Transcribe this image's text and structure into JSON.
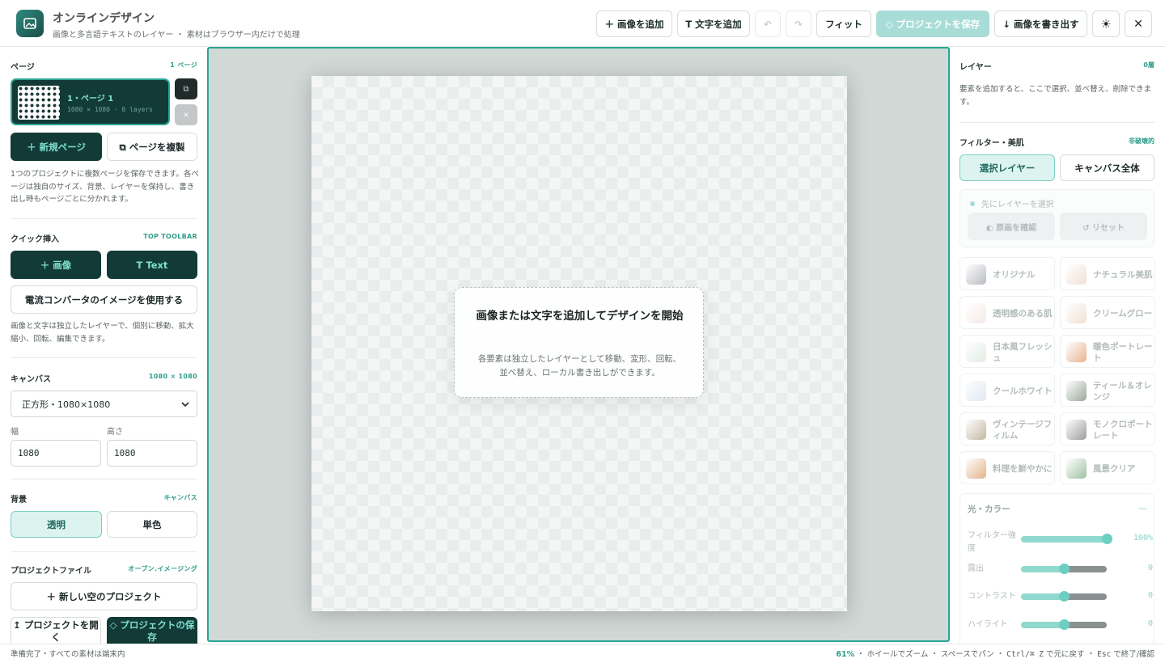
{
  "header": {
    "title": "オンラインデザイン",
    "subtitle": "画像と多言語テキストのレイヤー ・ 素材はブラウザー内だけで処理",
    "buttons": {
      "add_image": "＋ 画像を追加",
      "add_text": "T 文字を追加",
      "undo": "↶",
      "redo": "↷",
      "fit": "フィット",
      "save_project": "◇ プロジェクトを保存",
      "export": "↓ 画像を書き出す",
      "theme": "☀",
      "close": "✕"
    }
  },
  "left": {
    "pages": {
      "label": "ページ",
      "count": "1 ページ",
      "card_name": "1・ページ 1",
      "card_meta": "1080 × 1080 · 0 layers",
      "dup_icon": "⧉",
      "del_icon": "×",
      "new_page": "＋ 新規ページ",
      "duplicate_page": "⧉ ページを複製",
      "help": "1つのプロジェクトに複数ページを保存できます。各ページは独自のサイズ、背景、レイヤーを保持し、書き出し時もページごとに分かれます。"
    },
    "quick": {
      "label": "クイック挿入",
      "tag": "TOP TOOLBAR",
      "image": "＋ 画像",
      "text": "T Text",
      "converter": "電流コンバータのイメージを使用する",
      "help": "画像と文字は独立したレイヤーで、個別に移動、拡大縮小、回転、編集できます。"
    },
    "canvas": {
      "label": "キャンバス",
      "size": "1080 × 1080",
      "preset": "正方形・1080×1080",
      "width_label": "幅",
      "height_label": "高さ",
      "width": "1080",
      "height": "1080"
    },
    "background": {
      "label": "背景",
      "tag": "キャンバス",
      "transparent": "透明",
      "solid": "単色"
    },
    "project": {
      "label": "プロジェクトファイル",
      "tag": "オープン.イメージング",
      "new_empty": "＋ 新しい空のプロジェクト",
      "open": "↥ プロジェクトを開く",
      "save": "◇ プロジェクトの保存"
    }
  },
  "canvas_area": {
    "empty_title": "画像または文字を追加してデザインを開始",
    "empty_desc": "各要素は独立したレイヤーとして移動、変形、回転、並べ替え、ローカル書き出しができます。"
  },
  "right": {
    "layers": {
      "label": "レイヤー",
      "count": "0層",
      "help": "要素を追加すると、ここで選択、並べ替え、削除できます。"
    },
    "filters": {
      "label": "フィルター・美肌",
      "tag": "非破壊的",
      "scope_layer": "選択レイヤー",
      "scope_canvas": "キャンバス全体",
      "hint": "先にレイヤーを選択",
      "compare": "◐ 原画を確認",
      "reset": "↺ リセット",
      "presets": [
        {
          "name": "オリジナル",
          "color": "#b8bcc2"
        },
        {
          "name": "ナチュラル美肌",
          "color": "#f3e0d6"
        },
        {
          "name": "透明感のある肌",
          "color": "#f5eae6"
        },
        {
          "name": "クリームグロー",
          "color": "#f2e2d4"
        },
        {
          "name": "日本風フレッシュ",
          "color": "#e2ece4"
        },
        {
          "name": "暖色ポートレート",
          "color": "#e7b392"
        },
        {
          "name": "クールホワイト",
          "color": "#dfe8f0"
        },
        {
          "name": "ティール＆オレンジ",
          "color": "#9aa89a"
        },
        {
          "name": "ヴィンテージフィルム",
          "color": "#c2b7a2"
        },
        {
          "name": "モノクロポートレート",
          "color": "#9c9c9c"
        },
        {
          "name": "料理を鮮やかに",
          "color": "#e2b28a"
        },
        {
          "name": "風景クリア",
          "color": "#9cc2a2"
        }
      ]
    },
    "adjust": {
      "title": "光・カラー",
      "collapse": "—",
      "sliders": [
        {
          "label": "フィルター強度",
          "value": 100,
          "display": "100%"
        },
        {
          "label": "露出",
          "value": 0,
          "display": "0"
        },
        {
          "label": "コントラスト",
          "value": 0,
          "display": "0"
        },
        {
          "label": "ハイライト",
          "value": 0,
          "display": "0"
        }
      ]
    }
  },
  "status": {
    "left": "準備完了・すべての素材は端末内",
    "zoom": "61%",
    "hints": " ・ ホイールでズーム ・ スペースでパン ・ ",
    "undo_key": "Ctrl/⌘ Z",
    "undo_text": " で元に戻す ・ ",
    "esc_key": "Esc",
    "esc_text": " で終了/確認"
  }
}
